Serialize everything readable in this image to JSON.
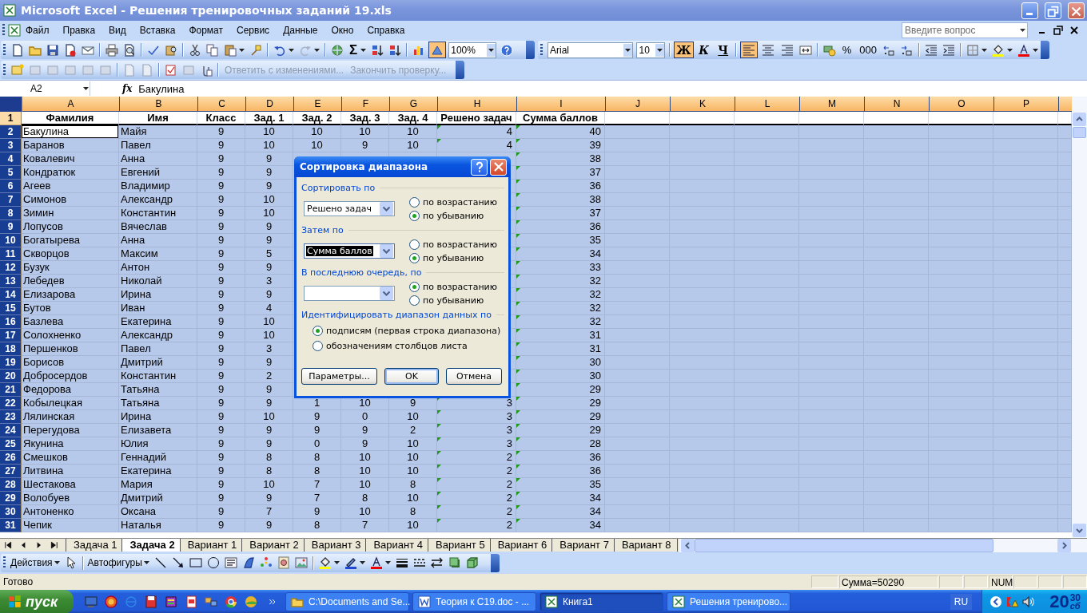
{
  "window": {
    "title": "Microsoft Excel - Решения тренировочных заданий 19.xls"
  },
  "menu": [
    "Файл",
    "Правка",
    "Вид",
    "Вставка",
    "Формат",
    "Сервис",
    "Данные",
    "Окно",
    "Справка"
  ],
  "help_search": {
    "placeholder": "Введите вопрос"
  },
  "standard_toolbar": {
    "autosum": "Σ",
    "drawing_on": true,
    "zoom": "100%"
  },
  "format_toolbar": {
    "font": "Arial",
    "size": "10",
    "styles": [
      {
        "label": "Ж",
        "kind": "bold",
        "on": true
      },
      {
        "label": "К",
        "kind": "italic",
        "on": false
      },
      {
        "label": "Ч",
        "kind": "underline",
        "on": false
      }
    ],
    "alignments": [
      {
        "kind": "left",
        "selected": true
      },
      {
        "kind": "center",
        "selected": false
      },
      {
        "kind": "right",
        "selected": false
      }
    ],
    "percent": "%",
    "thousands": "000"
  },
  "review_toolbar": {
    "reply": {
      "label": "Ответить с изменениями...",
      "disabled": true
    },
    "finish": {
      "label": "Закончить проверку...",
      "disabled": true
    }
  },
  "formula_bar": {
    "name_box": "A2",
    "function_label": "fx",
    "value": "Бакулина"
  },
  "sheet": {
    "columns": [
      "A",
      "B",
      "C",
      "D",
      "E",
      "F",
      "G",
      "H",
      "I",
      "J",
      "K",
      "L",
      "M",
      "N",
      "O",
      "P"
    ],
    "header_row": {
      "number": "1",
      "cells": [
        "Фамилия",
        "Имя",
        "Класс",
        "Зад. 1",
        "Зад. 2",
        "Зад. 3",
        "Зад. 4",
        "Решено задач",
        "Сумма баллов"
      ]
    },
    "rows": [
      {
        "number": "2",
        "selected": true,
        "active": true,
        "flagged": true,
        "cells": [
          "Бакулина",
          "Майя",
          "9",
          "10",
          "10",
          "10",
          "10",
          "4",
          "40"
        ]
      },
      {
        "number": "3",
        "selected": true,
        "active": false,
        "flagged": true,
        "cells": [
          "Баранов",
          "Павел",
          "9",
          "10",
          "10",
          "9",
          "10",
          "4",
          "39"
        ]
      },
      {
        "number": "4",
        "selected": true,
        "active": false,
        "flagged": true,
        "cells": [
          "Ковалевич",
          "Анна",
          "9",
          "9",
          null,
          null,
          null,
          null,
          "38"
        ]
      },
      {
        "number": "5",
        "selected": true,
        "active": false,
        "flagged": true,
        "cells": [
          "Кондратюк",
          "Евгений",
          "9",
          "9",
          null,
          null,
          null,
          null,
          "37"
        ]
      },
      {
        "number": "6",
        "selected": true,
        "active": false,
        "flagged": true,
        "cells": [
          "Агеев",
          "Владимир",
          "9",
          "9",
          null,
          null,
          null,
          null,
          "36"
        ]
      },
      {
        "number": "7",
        "selected": true,
        "active": false,
        "flagged": true,
        "cells": [
          "Симонов",
          "Александр",
          "9",
          "10",
          null,
          null,
          null,
          null,
          "38"
        ]
      },
      {
        "number": "8",
        "selected": true,
        "active": false,
        "flagged": true,
        "cells": [
          "Зимин",
          "Константин",
          "9",
          "10",
          null,
          null,
          null,
          null,
          "37"
        ]
      },
      {
        "number": "9",
        "selected": true,
        "active": false,
        "flagged": true,
        "cells": [
          "Лопусов",
          "Вячеслав",
          "9",
          "9",
          null,
          null,
          null,
          null,
          "36"
        ]
      },
      {
        "number": "10",
        "selected": true,
        "active": false,
        "flagged": true,
        "cells": [
          "Богатырева",
          "Анна",
          "9",
          "9",
          null,
          null,
          null,
          null,
          "35"
        ]
      },
      {
        "number": "11",
        "selected": true,
        "active": false,
        "flagged": true,
        "cells": [
          "Скворцов",
          "Максим",
          "9",
          "5",
          null,
          null,
          null,
          null,
          "34"
        ]
      },
      {
        "number": "12",
        "selected": true,
        "active": false,
        "flagged": true,
        "cells": [
          "Бузук",
          "Антон",
          "9",
          "9",
          null,
          null,
          null,
          null,
          "33"
        ]
      },
      {
        "number": "13",
        "selected": true,
        "active": false,
        "flagged": true,
        "cells": [
          "Лебедев",
          "Николай",
          "9",
          "3",
          null,
          null,
          null,
          null,
          "32"
        ]
      },
      {
        "number": "14",
        "selected": true,
        "active": false,
        "flagged": true,
        "cells": [
          "Елизарова",
          "Ирина",
          "9",
          "9",
          null,
          null,
          null,
          null,
          "32"
        ]
      },
      {
        "number": "15",
        "selected": true,
        "active": false,
        "flagged": true,
        "cells": [
          "Бутов",
          "Иван",
          "9",
          "4",
          null,
          null,
          null,
          null,
          "32"
        ]
      },
      {
        "number": "16",
        "selected": true,
        "active": false,
        "flagged": true,
        "cells": [
          "Базлева",
          "Екатерина",
          "9",
          "10",
          null,
          null,
          null,
          null,
          "32"
        ]
      },
      {
        "number": "17",
        "selected": true,
        "active": false,
        "flagged": true,
        "cells": [
          "Солохненко",
          "Александр",
          "9",
          "10",
          null,
          null,
          null,
          null,
          "31"
        ]
      },
      {
        "number": "18",
        "selected": true,
        "active": false,
        "flagged": true,
        "cells": [
          "Першенков",
          "Павел",
          "9",
          "3",
          null,
          null,
          null,
          null,
          "31"
        ]
      },
      {
        "number": "19",
        "selected": true,
        "active": false,
        "flagged": true,
        "cells": [
          "Борисов",
          "Дмитрий",
          "9",
          "9",
          null,
          null,
          null,
          null,
          "30"
        ]
      },
      {
        "number": "20",
        "selected": true,
        "active": false,
        "flagged": true,
        "cells": [
          "Добросердов",
          "Константин",
          "9",
          "2",
          null,
          null,
          null,
          null,
          "30"
        ]
      },
      {
        "number": "21",
        "selected": true,
        "active": false,
        "flagged": true,
        "cells": [
          "Федорова",
          "Татьяна",
          "9",
          "9",
          null,
          null,
          null,
          null,
          "29"
        ]
      },
      {
        "number": "22",
        "selected": true,
        "active": false,
        "flagged": true,
        "cells": [
          "Кобылецкая",
          "Татьяна",
          "9",
          "9",
          "1",
          "10",
          "9",
          "3",
          "29"
        ]
      },
      {
        "number": "23",
        "selected": true,
        "active": false,
        "flagged": true,
        "cells": [
          "Лялинская",
          "Ирина",
          "9",
          "10",
          "9",
          "0",
          "10",
          "3",
          "29"
        ]
      },
      {
        "number": "24",
        "selected": true,
        "active": false,
        "flagged": true,
        "cells": [
          "Перегудова",
          "Елизавета",
          "9",
          "9",
          "9",
          "9",
          "2",
          "3",
          "29"
        ]
      },
      {
        "number": "25",
        "selected": true,
        "active": false,
        "flagged": true,
        "cells": [
          "Якунина",
          "Юлия",
          "9",
          "9",
          "0",
          "9",
          "10",
          "3",
          "28"
        ]
      },
      {
        "number": "26",
        "selected": true,
        "active": false,
        "flagged": true,
        "cells": [
          "Смешков",
          "Геннадий",
          "9",
          "8",
          "8",
          "10",
          "10",
          "2",
          "36"
        ]
      },
      {
        "number": "27",
        "selected": true,
        "active": false,
        "flagged": true,
        "cells": [
          "Литвина",
          "Екатерина",
          "9",
          "8",
          "8",
          "10",
          "10",
          "2",
          "36"
        ]
      },
      {
        "number": "28",
        "selected": true,
        "active": false,
        "flagged": true,
        "cells": [
          "Шестакова",
          "Мария",
          "9",
          "10",
          "7",
          "10",
          "8",
          "2",
          "35"
        ]
      },
      {
        "number": "29",
        "selected": true,
        "active": false,
        "flagged": true,
        "cells": [
          "Волобуев",
          "Дмитрий",
          "9",
          "9",
          "7",
          "8",
          "10",
          "2",
          "34"
        ]
      },
      {
        "number": "30",
        "selected": true,
        "active": false,
        "flagged": true,
        "cells": [
          "Антоненко",
          "Оксана",
          "9",
          "7",
          "9",
          "10",
          "8",
          "2",
          "34"
        ]
      },
      {
        "number": "31",
        "selected": true,
        "active": false,
        "flagged": true,
        "cells": [
          "Чепик",
          "Наталья",
          "9",
          "9",
          "8",
          "7",
          "10",
          "2",
          "34"
        ]
      }
    ]
  },
  "dialog": {
    "title": "Сортировка диапазона",
    "groups": [
      {
        "label": "Сортировать по",
        "value": "Решено задач",
        "highlighted": false,
        "options": [
          {
            "label": "по возрастанию",
            "selected": false
          },
          {
            "label": "по убыванию",
            "selected": true
          }
        ]
      },
      {
        "label": "Затем по",
        "value": "Сумма баллов",
        "highlighted": true,
        "options": [
          {
            "label": "по возрастанию",
            "selected": false
          },
          {
            "label": "по убыванию",
            "selected": true
          }
        ]
      },
      {
        "label": "В последнюю очередь, по",
        "highlighted": false,
        "options": [
          {
            "label": "по возрастанию",
            "selected": true
          },
          {
            "label": "по убыванию",
            "selected": false
          }
        ]
      }
    ],
    "identify": {
      "label": "Идентифицировать диапазон данных по",
      "options": [
        {
          "label": "подписям (первая строка диапазона)",
          "selected": true
        },
        {
          "label": "обозначениям столбцов листа",
          "selected": false
        }
      ]
    },
    "buttons": [
      {
        "label": "Параметры...",
        "default": false
      },
      {
        "label": "OK",
        "default": true
      },
      {
        "label": "Отмена",
        "default": false
      }
    ]
  },
  "sheet_tabs": [
    {
      "label": "Задача 1",
      "selected": false
    },
    {
      "label": "Задача 2",
      "selected": true
    },
    {
      "label": "Вариант 1",
      "selected": false
    },
    {
      "label": "Вариант 2",
      "selected": false
    },
    {
      "label": "Вариант 3",
      "selected": false
    },
    {
      "label": "Вариант 4",
      "selected": false
    },
    {
      "label": "Вариант 5",
      "selected": false
    },
    {
      "label": "Вариант 6",
      "selected": false
    },
    {
      "label": "Вариант 7",
      "selected": false
    },
    {
      "label": "Вариант 8",
      "selected": false
    }
  ],
  "drawing_toolbar": {
    "actions": "Действия",
    "autoshapes": "Автофигуры"
  },
  "status_bar": {
    "status": "Готово",
    "sum": "Сумма=50290",
    "num": "NUM"
  },
  "taskbar": {
    "start": "пуск",
    "tasks": [
      {
        "label": "C:\\Documents and Se...",
        "kind": "folder",
        "selected": false
      },
      {
        "label": "Теория к С19.doc - ...",
        "kind": "word",
        "selected": false
      },
      {
        "label": "Книга1",
        "kind": "excel",
        "selected": true
      },
      {
        "label": "Решения тренирово...",
        "kind": "excel",
        "selected": false
      }
    ],
    "language": "RU",
    "clock": {
      "hours": "20",
      "minutes": "30",
      "day": "сб"
    }
  }
}
